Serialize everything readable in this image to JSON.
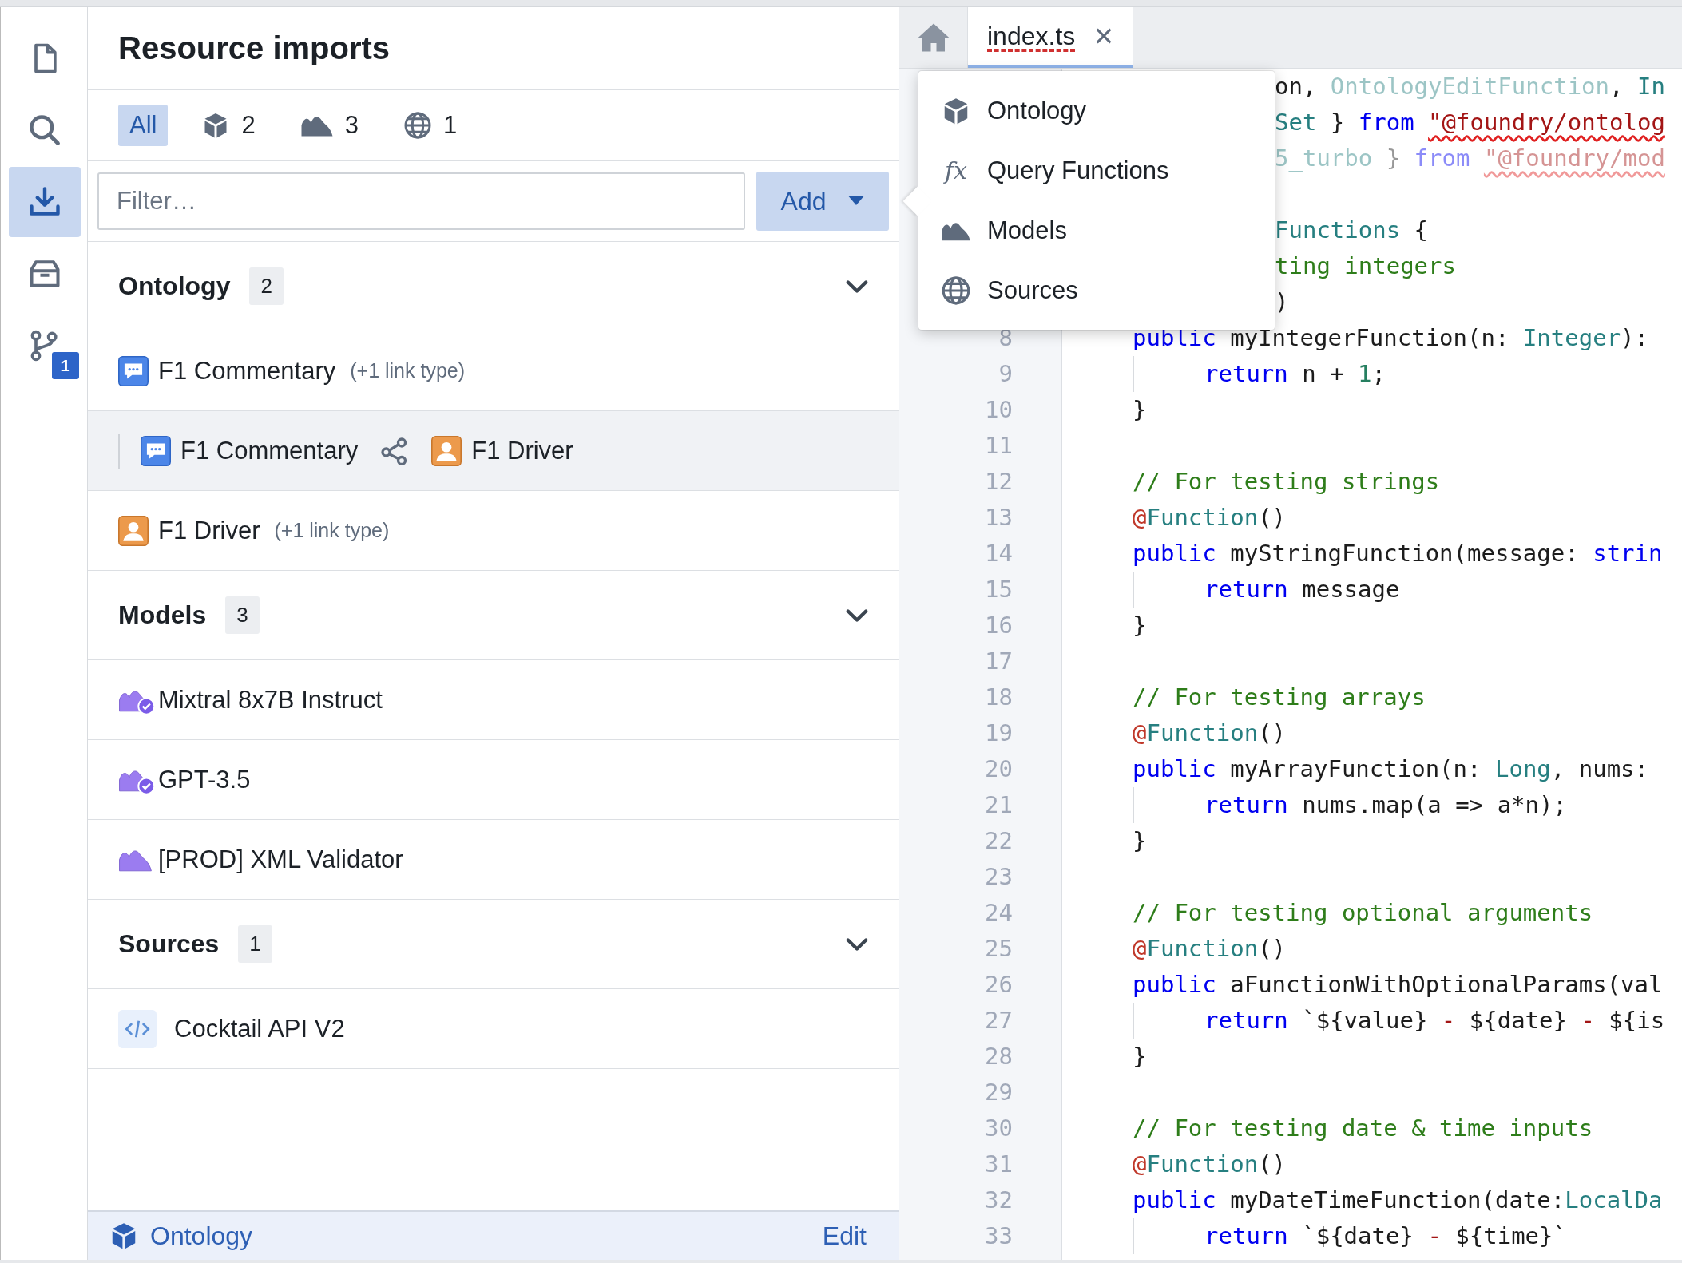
{
  "rail": [
    {
      "kind": "file",
      "selected": false
    },
    {
      "kind": "search",
      "selected": false
    },
    {
      "kind": "import",
      "selected": true
    },
    {
      "kind": "archive",
      "selected": false
    },
    {
      "kind": "branch",
      "selected": false,
      "badge": "1"
    }
  ],
  "panel": {
    "title": "Resource imports",
    "filters": [
      {
        "kind": "all",
        "label": "All",
        "selected": true
      },
      {
        "kind": "ontology",
        "label": "2",
        "selected": false
      },
      {
        "kind": "models",
        "label": "3",
        "selected": false
      },
      {
        "kind": "sources",
        "label": "1",
        "selected": false
      }
    ],
    "filter_field": {
      "placeholder": "Filter…"
    },
    "add_button": {
      "label": "Add"
    },
    "sections": [
      {
        "title": "Ontology",
        "count": "2",
        "expanded": true,
        "items": [
          {
            "kind": "message-object",
            "label": "F1 Commentary",
            "note": "(+1 link type)",
            "selected": false
          },
          {
            "kind": "link",
            "from": {
              "kind": "message",
              "label": "F1 Commentary"
            },
            "to": {
              "kind": "person",
              "label": "F1 Driver"
            },
            "selected": true
          },
          {
            "kind": "person-object",
            "label": "F1 Driver",
            "note": "(+1 link type)",
            "selected": false
          }
        ]
      },
      {
        "title": "Models",
        "count": "3",
        "expanded": true,
        "items": [
          {
            "kind": "model",
            "label": "Mixtral 8x7B Instruct",
            "verified": true,
            "selected": false
          },
          {
            "kind": "model",
            "label": "GPT-3.5",
            "verified": true,
            "selected": false
          },
          {
            "kind": "model",
            "label": "[PROD] XML Validator",
            "verified": false,
            "selected": false
          }
        ]
      },
      {
        "title": "Sources",
        "count": "1",
        "expanded": true,
        "items": [
          {
            "kind": "source",
            "label": "Cocktail API V2",
            "selected": false
          }
        ]
      }
    ],
    "footer": {
      "link": "Ontology",
      "action": "Edit"
    }
  },
  "editor": {
    "tabs": [
      {
        "label": "index.ts",
        "selected": true,
        "spell_error": true
      }
    ],
    "menu": [
      {
        "kind": "ontology",
        "label": "Ontology"
      },
      {
        "kind": "functions",
        "glyph": "fx",
        "label": "Query Functions"
      },
      {
        "kind": "models",
        "label": "Models"
      },
      {
        "kind": "sources",
        "label": "Sources"
      }
    ],
    "lines": [
      {
        "tokens": [
          {
            "kind": "plain",
            "text": "on, "
          },
          {
            "kind": "type",
            "text": "OntologyEditFunction",
            "faded": true
          },
          {
            "kind": "plain",
            "text": ", "
          },
          {
            "kind": "type",
            "text": "In"
          }
        ]
      },
      {
        "tokens": [
          {
            "kind": "type",
            "text": "Set"
          },
          {
            "kind": "plain",
            "text": " } "
          },
          {
            "kind": "keyword",
            "text": "from "
          },
          {
            "kind": "string",
            "text": "\"@foundry/ontolog",
            "squiggle": true
          }
        ]
      },
      {
        "tokens": [
          {
            "kind": "type",
            "text": "5_turbo",
            "faded": true
          },
          {
            "kind": "plain",
            "text": " } ",
            "faded": true
          },
          {
            "kind": "keyword",
            "text": "from ",
            "faded": true
          },
          {
            "kind": "string",
            "text": "\"@foundry/mod",
            "faded": true,
            "squiggle": true
          }
        ]
      },
      {
        "kind": "blank"
      },
      {
        "tokens": [
          {
            "kind": "type",
            "text": "Functions"
          },
          {
            "kind": "plain",
            "text": " {"
          }
        ]
      },
      {
        "tokens": [
          {
            "kind": "comment",
            "text": "ting integers"
          }
        ]
      },
      {
        "tokens": [
          {
            "kind": "plain",
            "text": ")"
          }
        ]
      },
      {
        "num": "8",
        "tokens": [
          {
            "kind": "keyword",
            "text": "public"
          },
          {
            "kind": "plain",
            "text": " myIntegerFunction(n: "
          },
          {
            "kind": "type",
            "text": "Integer"
          },
          {
            "kind": "plain",
            "text": "):"
          }
        ]
      },
      {
        "num": "9",
        "indented": true,
        "tokens": [
          {
            "kind": "keyword",
            "text": "return"
          },
          {
            "kind": "plain",
            "text": " n + "
          },
          {
            "kind": "number",
            "text": "1"
          },
          {
            "kind": "plain",
            "text": ";"
          }
        ]
      },
      {
        "num": "10",
        "tokens": [
          {
            "kind": "plain",
            "text": "}"
          }
        ]
      },
      {
        "num": "11"
      },
      {
        "num": "12",
        "tokens": [
          {
            "kind": "comment",
            "text": "// For testing strings"
          }
        ]
      },
      {
        "num": "13",
        "tokens": [
          {
            "kind": "decorator",
            "text": "@"
          },
          {
            "kind": "type",
            "text": "Function"
          },
          {
            "kind": "plain",
            "text": "()"
          }
        ]
      },
      {
        "num": "14",
        "tokens": [
          {
            "kind": "keyword",
            "text": "public"
          },
          {
            "kind": "plain",
            "text": " myStringFunction(message: "
          },
          {
            "kind": "keyword",
            "text": "strin"
          }
        ]
      },
      {
        "num": "15",
        "indented": true,
        "tokens": [
          {
            "kind": "keyword",
            "text": "return"
          },
          {
            "kind": "plain",
            "text": " message"
          }
        ]
      },
      {
        "num": "16",
        "tokens": [
          {
            "kind": "plain",
            "text": "}"
          }
        ]
      },
      {
        "num": "17"
      },
      {
        "num": "18",
        "tokens": [
          {
            "kind": "comment",
            "text": "// For testing arrays"
          }
        ]
      },
      {
        "num": "19",
        "tokens": [
          {
            "kind": "decorator",
            "text": "@"
          },
          {
            "kind": "type",
            "text": "Function"
          },
          {
            "kind": "plain",
            "text": "()"
          }
        ]
      },
      {
        "num": "20",
        "tokens": [
          {
            "kind": "keyword",
            "text": "public"
          },
          {
            "kind": "plain",
            "text": " myArrayFunction(n: "
          },
          {
            "kind": "type",
            "text": "Long"
          },
          {
            "kind": "plain",
            "text": ", nums:"
          }
        ]
      },
      {
        "num": "21",
        "indented": true,
        "tokens": [
          {
            "kind": "keyword",
            "text": "return"
          },
          {
            "kind": "plain",
            "text": " nums.map(a => a*n);"
          }
        ]
      },
      {
        "num": "22",
        "tokens": [
          {
            "kind": "plain",
            "text": "}"
          }
        ]
      },
      {
        "num": "23"
      },
      {
        "num": "24",
        "tokens": [
          {
            "kind": "comment",
            "text": "// For testing optional arguments"
          }
        ]
      },
      {
        "num": "25",
        "tokens": [
          {
            "kind": "decorator",
            "text": "@"
          },
          {
            "kind": "type",
            "text": "Function"
          },
          {
            "kind": "plain",
            "text": "()"
          }
        ]
      },
      {
        "num": "26",
        "tokens": [
          {
            "kind": "keyword",
            "text": "public"
          },
          {
            "kind": "plain",
            "text": " aFunctionWithOptionalParams(val"
          }
        ]
      },
      {
        "num": "27",
        "indented": true,
        "tokens": [
          {
            "kind": "keyword",
            "text": "return"
          },
          {
            "kind": "plain",
            "text": " `${value} "
          },
          {
            "kind": "operator",
            "text": "-"
          },
          {
            "kind": "plain",
            "text": " ${date} "
          },
          {
            "kind": "operator",
            "text": "-"
          },
          {
            "kind": "plain",
            "text": " ${is"
          }
        ]
      },
      {
        "num": "28",
        "tokens": [
          {
            "kind": "plain",
            "text": "}"
          }
        ]
      },
      {
        "num": "29"
      },
      {
        "num": "30",
        "tokens": [
          {
            "kind": "comment",
            "text": "// For testing date & time inputs"
          }
        ]
      },
      {
        "num": "31",
        "tokens": [
          {
            "kind": "decorator",
            "text": "@"
          },
          {
            "kind": "type",
            "text": "Function"
          },
          {
            "kind": "plain",
            "text": "()"
          }
        ]
      },
      {
        "num": "32",
        "tokens": [
          {
            "kind": "keyword",
            "text": "public"
          },
          {
            "kind": "plain",
            "text": " myDateTimeFunction(date:"
          },
          {
            "kind": "type",
            "text": "LocalDa"
          }
        ]
      },
      {
        "num": "33",
        "indented": true,
        "tokens": [
          {
            "kind": "keyword",
            "text": "return"
          },
          {
            "kind": "plain",
            "text": " `${date} "
          },
          {
            "kind": "operator",
            "text": "-"
          },
          {
            "kind": "plain",
            "text": " ${time}`"
          }
        ]
      }
    ]
  }
}
